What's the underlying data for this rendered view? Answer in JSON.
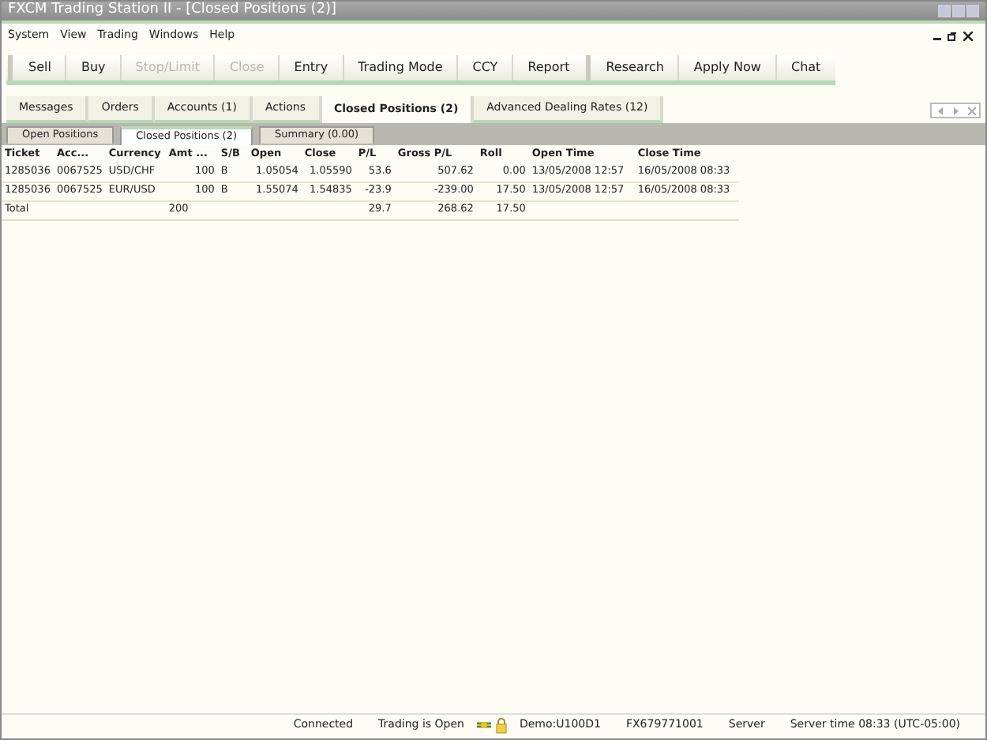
{
  "window": {
    "title": "FXCM Trading Station II - [Closed Positions (2)]"
  },
  "menu": [
    "System",
    "View",
    "Trading",
    "Windows",
    "Help"
  ],
  "toolbar": [
    {
      "label": "Sell",
      "disabled": false
    },
    {
      "label": "Buy",
      "disabled": false
    },
    {
      "label": "Stop/Limit",
      "disabled": true
    },
    {
      "label": "Close",
      "disabled": true
    },
    {
      "label": "Entry",
      "disabled": false
    },
    {
      "label": "Trading Mode",
      "disabled": false
    },
    {
      "label": "CCY",
      "disabled": false
    },
    {
      "label": "Report",
      "disabled": false
    },
    {
      "label": "Research",
      "disabled": false
    },
    {
      "label": "Apply Now",
      "disabled": false
    },
    {
      "label": "Chat",
      "disabled": false
    }
  ],
  "tabs": [
    {
      "label": "Messages",
      "selected": false
    },
    {
      "label": "Orders",
      "selected": false
    },
    {
      "label": "Accounts (1)",
      "selected": false
    },
    {
      "label": "Actions",
      "selected": false
    },
    {
      "label": "Closed Positions (2)",
      "selected": true
    },
    {
      "label": "Advanced Dealing Rates (12)",
      "selected": false
    }
  ],
  "subtabs": [
    {
      "label": "Open Positions",
      "selected": false
    },
    {
      "label": "Closed Positions (2)",
      "selected": true
    },
    {
      "label": "Summary (0.00)",
      "selected": false
    }
  ],
  "table": {
    "columns": [
      "Ticket",
      "Acc...",
      "Currency",
      "Amt ...",
      "S/B",
      "Open",
      "Close",
      "P/L",
      "Gross P/L",
      "Roll",
      "Open Time",
      "Close Time"
    ],
    "rows": [
      {
        "cells": [
          "1285036",
          "0067525",
          "USD/CHF",
          "100",
          "B",
          "1.05054",
          "1.05590",
          "53.6",
          "507.62",
          "0.00",
          "13/05/2008 12:57",
          "16/05/2008 08:33"
        ]
      },
      {
        "cells": [
          "1285036",
          "0067525",
          "EUR/USD",
          "100",
          "B",
          "1.55074",
          "1.54835",
          "-23.9",
          "-239.00",
          "17.50",
          "13/05/2008 12:57",
          "16/05/2008 08:33"
        ]
      }
    ],
    "total": {
      "label": "Total",
      "amount": "200",
      "pl": "29.7",
      "gross_pl": "268.62",
      "roll": "17.50"
    }
  },
  "status_bar": {
    "connection": "Connected",
    "trading": "Trading is Open",
    "account": "Demo:U100D1",
    "login": "FX679771001",
    "server": "Server",
    "server_time": "Server time 08:33 (UTC-05:00)"
  }
}
